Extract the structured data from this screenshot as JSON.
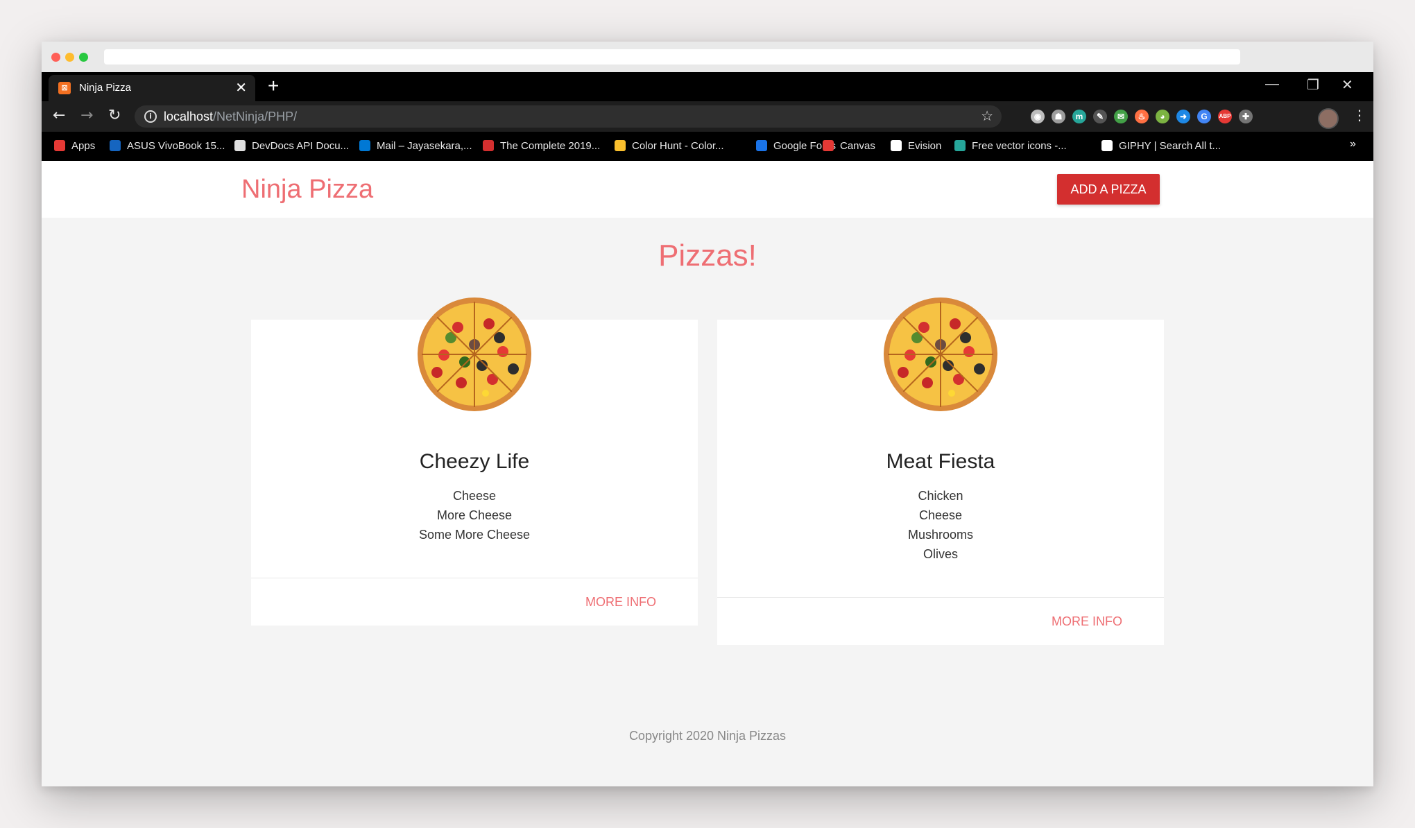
{
  "browser": {
    "tab": {
      "title": "Ninja Pizza",
      "close": "✕"
    },
    "new_tab": "+",
    "window_controls": {
      "minimize": "—",
      "restore": "❐",
      "close": "✕"
    },
    "nav": {
      "back": "←",
      "forward": "→",
      "reload": "↻"
    },
    "address": {
      "host": "localhost",
      "path": "/NetNinja/PHP/"
    },
    "bookmarks": [
      {
        "label": "Apps",
        "color": "#e53935"
      },
      {
        "label": "ASUS VivoBook 15...",
        "color": "#1565c0"
      },
      {
        "label": "DevDocs API Docu...",
        "color": "#e0e0e0"
      },
      {
        "label": "Mail – Jayasekara,...",
        "color": "#0078d4"
      },
      {
        "label": "The Complete 2019...",
        "color": "#d32f2f"
      },
      {
        "label": "Color Hunt - Color...",
        "color": "#fbc02d"
      },
      {
        "label": "Google Fonts",
        "color": "#1a73e8"
      },
      {
        "label": "Canvas",
        "color": "#e53935"
      },
      {
        "label": "Evision",
        "color": "#ffffff"
      },
      {
        "label": "Free vector icons -...",
        "color": "#26a69a"
      },
      {
        "label": "GIPHY | Search All t...",
        "color": "#ffffff"
      }
    ],
    "bookmarks_more": "»",
    "extensions": [
      {
        "icon": "camera-icon",
        "color": "#bdbdbd",
        "glyph": "◉"
      },
      {
        "icon": "robot-icon",
        "color": "#9e9e9e",
        "glyph": "☗"
      },
      {
        "icon": "m-extension-icon",
        "color": "#26a69a",
        "glyph": "m"
      },
      {
        "icon": "pen-icon",
        "color": "#555555",
        "glyph": "✎"
      },
      {
        "icon": "mail-check-icon",
        "color": "#43a047",
        "glyph": "✉"
      },
      {
        "icon": "fire-icon",
        "color": "#ff7043",
        "glyph": "♨"
      },
      {
        "icon": "color-wheel-icon",
        "color": "#7cb342",
        "glyph": "◕"
      },
      {
        "icon": "arrow-extension-icon",
        "color": "#1e88e5",
        "glyph": "➜"
      },
      {
        "icon": "translate-icon",
        "color": "#4285f4",
        "glyph": "G"
      },
      {
        "icon": "adblock-icon",
        "color": "#e53935",
        "glyph": "ABP"
      },
      {
        "icon": "puzzle-icon",
        "color": "#757575",
        "glyph": "✚"
      }
    ]
  },
  "site": {
    "brand": "Ninja Pizza",
    "add_button": "ADD A PIZZA",
    "heading": "Pizzas!",
    "pizzas": [
      {
        "title": "Cheezy Life",
        "ingredients": [
          "Cheese",
          "More Cheese",
          "Some More Cheese"
        ],
        "action": "MORE INFO"
      },
      {
        "title": "Meat Fiesta",
        "ingredients": [
          "Chicken",
          "Cheese",
          "Mushrooms",
          "Olives"
        ],
        "action": "MORE INFO"
      }
    ],
    "footer": "Copyright 2020 Ninja Pizzas"
  },
  "colors": {
    "brand": "#ee6e73",
    "button": "#d32f2f"
  }
}
